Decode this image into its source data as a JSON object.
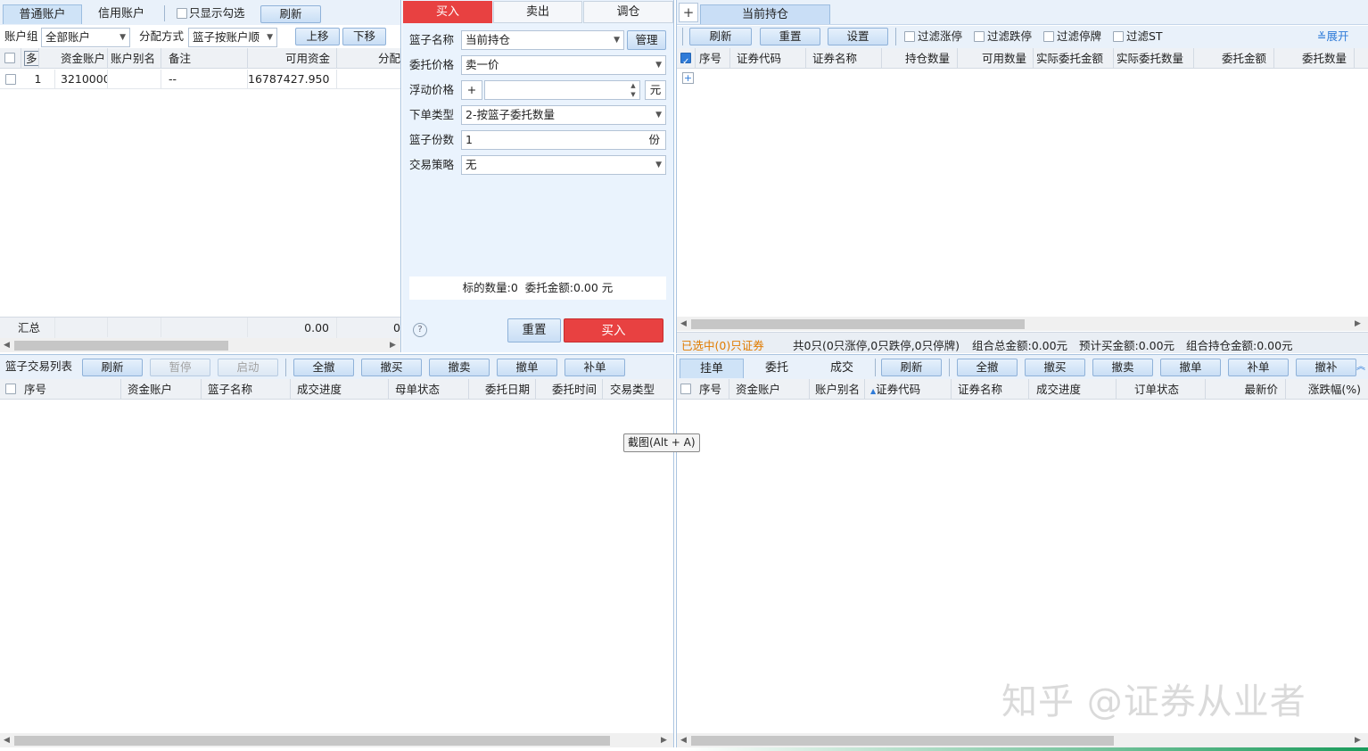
{
  "left_top": {
    "tabs": [
      "普通账户",
      "信用账户"
    ],
    "only_checked_label": "只显示勾选",
    "refresh": "刷新",
    "account_group_label": "账户组",
    "account_group_value": "全部账户",
    "alloc_label": "分配方式",
    "alloc_value": "篮子按账户顺",
    "move_up": "上移",
    "move_down": "下移",
    "columns": [
      "多",
      "资金账户",
      "账户别名",
      "备注",
      "可用资金",
      "分配"
    ],
    "rows": [
      {
        "no": "1",
        "account": "3210000",
        "alias": "",
        "note": "--",
        "available": "16787427.950",
        "alloc": ""
      }
    ],
    "summary_label": "汇总",
    "summary_available": "0.00",
    "summary_alloc": "0"
  },
  "order": {
    "tabs": [
      "买入",
      "卖出",
      "调仓"
    ],
    "basket_name_label": "篮子名称",
    "basket_name_value": "当前持仓",
    "manage": "管理",
    "price_label": "委托价格",
    "price_value": "卖一价",
    "float_label": "浮动价格",
    "float_sign": "+",
    "float_value": "",
    "float_unit": "元",
    "order_type_label": "下单类型",
    "order_type_value": "2-按篮子委托数量",
    "copies_label": "篮子份数",
    "copies_value": "1",
    "copies_unit": "份",
    "strategy_label": "交易策略",
    "strategy_value": "无",
    "summary": "标的数量:0  委托金额:0.00 元",
    "help": "?",
    "reset": "重置",
    "buy": "买入"
  },
  "right_top": {
    "add_tab": "+",
    "tab": "当前持仓",
    "refresh": "刷新",
    "reset": "重置",
    "settings": "设置",
    "filters": [
      "过滤涨停",
      "过滤跌停",
      "过滤停牌",
      "过滤ST"
    ],
    "expand": "展开",
    "columns": [
      "序号",
      "证券代码",
      "证券名称",
      "持仓数量",
      "可用数量",
      "实际委托金额",
      "实际委托数量",
      "委托金额",
      "委托数量"
    ],
    "plus": "+",
    "status_selected": "已选中(0)只证券",
    "status_total": "共0只(0只涨停,0只跌停,0只停牌)",
    "status_total_amount": "组合总金额:0.00元",
    "status_expected_buy": "预计买金额:0.00元",
    "status_hold_amount": "组合持仓金额:0.00元"
  },
  "left_bottom": {
    "title": "篮子交易列表",
    "buttons": [
      "刷新",
      "暂停",
      "启动",
      "全撤",
      "撤买",
      "撤卖",
      "撤单",
      "补单"
    ],
    "columns": [
      "序号",
      "资金账户",
      "篮子名称",
      "成交进度",
      "母单状态",
      "委托日期",
      "委托时间",
      "交易类型"
    ]
  },
  "right_bottom": {
    "tabs": [
      "挂单",
      "委托",
      "成交"
    ],
    "buttons": [
      "刷新",
      "全撤",
      "撤买",
      "撤卖",
      "撤单",
      "补单",
      "撤补"
    ],
    "columns": [
      "序号",
      "资金账户",
      "账户别名",
      "证券代码",
      "证券名称",
      "成交进度",
      "订单状态",
      "最新价",
      "涨跌幅(%)"
    ]
  },
  "tooltip": "截图(Alt + A)",
  "watermark": "知乎 @证券从业者"
}
